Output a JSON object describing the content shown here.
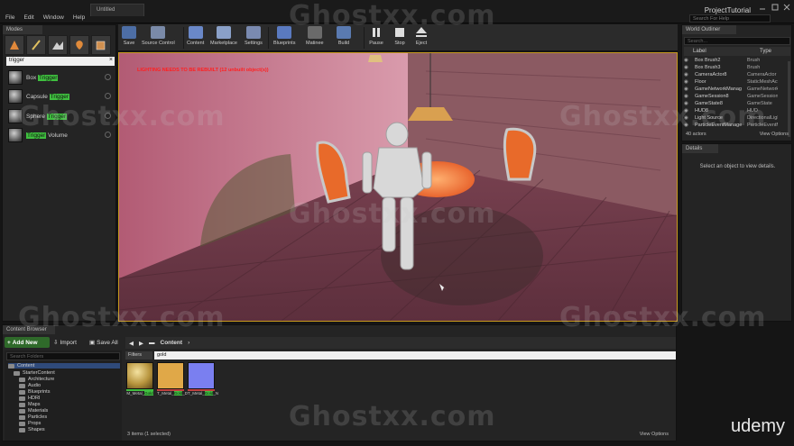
{
  "window": {
    "tab_title": "Untitled",
    "project_name": "ProjectTutorial",
    "search_help_placeholder": "Search For Help"
  },
  "menu": [
    "File",
    "Edit",
    "Window",
    "Help"
  ],
  "modes": {
    "tab": "Modes",
    "search_value": "trigger",
    "items": [
      {
        "pre": "Box ",
        "hl": "Trigger",
        "post": ""
      },
      {
        "pre": "Capsule ",
        "hl": "Trigger",
        "post": ""
      },
      {
        "pre": "Sphere ",
        "hl": "Trigger",
        "post": ""
      },
      {
        "pre": "",
        "hl": "Trigger",
        "post": " Volume"
      }
    ]
  },
  "toolbar": [
    {
      "label": "Save",
      "icon": "save-icon"
    },
    {
      "label": "Source Control",
      "icon": "source-control-icon"
    },
    {
      "label": "Content",
      "icon": "content-icon"
    },
    {
      "label": "Marketplace",
      "icon": "marketplace-icon"
    },
    {
      "label": "Settings",
      "icon": "settings-icon"
    },
    {
      "label": "Blueprints",
      "icon": "blueprints-icon"
    },
    {
      "label": "Matinee",
      "icon": "matinee-icon"
    },
    {
      "label": "Build",
      "icon": "build-icon"
    },
    {
      "label": "Pause",
      "icon": "pause-icon"
    },
    {
      "label": "Stop",
      "icon": "stop-icon"
    },
    {
      "label": "Eject",
      "icon": "eject-icon"
    }
  ],
  "viewport": {
    "warning": "LIGHTING NEEDS TO BE REBUILT (12 unbuilt object(s))"
  },
  "outliner": {
    "tab": "World Outliner",
    "search_placeholder": "Search...",
    "col_label": "Label",
    "col_type": "Type",
    "rows": [
      {
        "label": "Box Brush2",
        "type": "Brush"
      },
      {
        "label": "Box Brush3",
        "type": "Brush"
      },
      {
        "label": "CameraActor8",
        "type": "CameraActor"
      },
      {
        "label": "Floor",
        "type": "StaticMeshActor"
      },
      {
        "label": "GameNetworkManager",
        "type": "GameNetworkManager"
      },
      {
        "label": "GameSession8",
        "type": "GameSession"
      },
      {
        "label": "GameState8",
        "type": "GameState"
      },
      {
        "label": "HUD8",
        "type": "HUD"
      },
      {
        "label": "Light Source",
        "type": "DirectionalLight"
      },
      {
        "label": "ParticleEventManager",
        "type": "ParticleEventManager"
      }
    ],
    "actor_count": "40 actors",
    "view_options": "View Options"
  },
  "details": {
    "tab": "Details",
    "empty_text": "Select an object to view details."
  },
  "content_browser": {
    "tab": "Content Browser",
    "add_new": "Add New",
    "import": "Import",
    "save_all": "Save All",
    "path_root": "Content",
    "folder_search_placeholder": "Search Folders",
    "folders": [
      {
        "name": "Content",
        "level": 0
      },
      {
        "name": "StarterContent",
        "level": 1
      },
      {
        "name": "Architecture",
        "level": 2
      },
      {
        "name": "Audio",
        "level": 2
      },
      {
        "name": "Blueprints",
        "level": 2
      },
      {
        "name": "HDRI",
        "level": 2
      },
      {
        "name": "Maps",
        "level": 2
      },
      {
        "name": "Materials",
        "level": 2
      },
      {
        "name": "Particles",
        "level": 2
      },
      {
        "name": "Props",
        "level": 2
      },
      {
        "name": "Shapes",
        "level": 2
      }
    ],
    "filters": "Filters",
    "search_value": "gold",
    "assets": [
      {
        "pre": "M_Metal_",
        "hl": "Gold",
        "post": "",
        "color": "#b8953e",
        "bar": "#3fbf3f"
      },
      {
        "pre": "T_Metal_",
        "hl": "Gold",
        "post": "_D",
        "color": "#e0a848",
        "bar": "#c04040"
      },
      {
        "pre": "T_Metal_",
        "hl": "Gold",
        "post": "_N",
        "color": "#7a7ff0",
        "bar": "#c04040"
      }
    ],
    "items_count": "3 items (1 selected)",
    "view_options": "View Options"
  },
  "watermark": "Ghostxx.com",
  "brand": "udemy",
  "colors": {
    "accent_green": "#3fbf3f",
    "viewport_border": "#c79a1c",
    "warning_red": "#ff2020"
  }
}
